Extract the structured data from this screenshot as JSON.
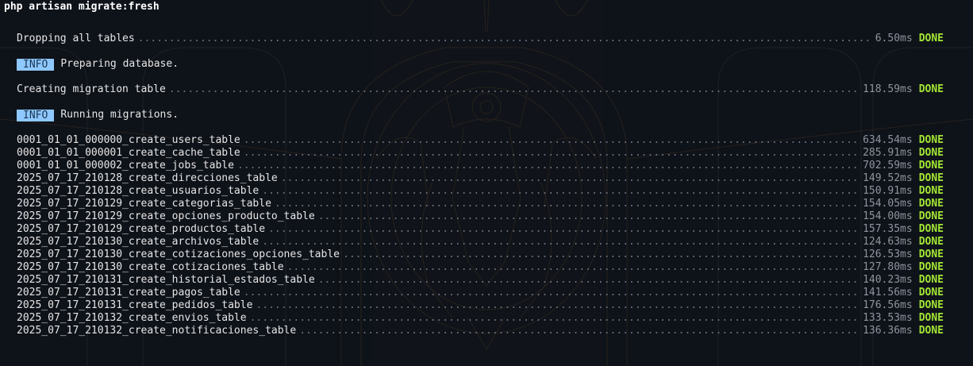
{
  "command": "php artisan migrate:fresh",
  "steps": {
    "drop": {
      "label": "Dropping all tables",
      "time": "6.50ms",
      "status": "DONE"
    },
    "info1": {
      "badge": "INFO",
      "text": "Preparing database."
    },
    "create_table": {
      "label": "Creating migration table",
      "time": "118.59ms",
      "status": "DONE"
    },
    "info2": {
      "badge": "INFO",
      "text": "Running migrations."
    }
  },
  "migrations": [
    {
      "name": "0001_01_01_000000_create_users_table",
      "time": "634.54ms",
      "status": "DONE"
    },
    {
      "name": "0001_01_01_000001_create_cache_table",
      "time": "285.91ms",
      "status": "DONE"
    },
    {
      "name": "0001_01_01_000002_create_jobs_table",
      "time": "702.59ms",
      "status": "DONE"
    },
    {
      "name": "2025_07_17_210128_create_direcciones_table",
      "time": "149.52ms",
      "status": "DONE"
    },
    {
      "name": "2025_07_17_210128_create_usuarios_table",
      "time": "150.91ms",
      "status": "DONE"
    },
    {
      "name": "2025_07_17_210129_create_categorias_table",
      "time": "154.05ms",
      "status": "DONE"
    },
    {
      "name": "2025_07_17_210129_create_opciones_producto_table",
      "time": "154.00ms",
      "status": "DONE"
    },
    {
      "name": "2025_07_17_210129_create_productos_table",
      "time": "157.35ms",
      "status": "DONE"
    },
    {
      "name": "2025_07_17_210130_create_archivos_table",
      "time": "124.63ms",
      "status": "DONE"
    },
    {
      "name": "2025_07_17_210130_create_cotizaciones_opciones_table",
      "time": "126.53ms",
      "status": "DONE"
    },
    {
      "name": "2025_07_17_210130_create_cotizaciones_table",
      "time": "127.80ms",
      "status": "DONE"
    },
    {
      "name": "2025_07_17_210131_create_historial_estados_table",
      "time": "140.23ms",
      "status": "DONE"
    },
    {
      "name": "2025_07_17_210131_create_pagos_table",
      "time": "141.56ms",
      "status": "DONE"
    },
    {
      "name": "2025_07_17_210131_create_pedidos_table",
      "time": "176.56ms",
      "status": "DONE"
    },
    {
      "name": "2025_07_17_210132_create_envios_table",
      "time": "133.53ms",
      "status": "DONE"
    },
    {
      "name": "2025_07_17_210132_create_notificaciones_table",
      "time": "136.36ms",
      "status": "DONE"
    }
  ],
  "colors": {
    "background": "#0e1219",
    "done": "#a3e635",
    "info_badge": "#8ec8ff"
  }
}
